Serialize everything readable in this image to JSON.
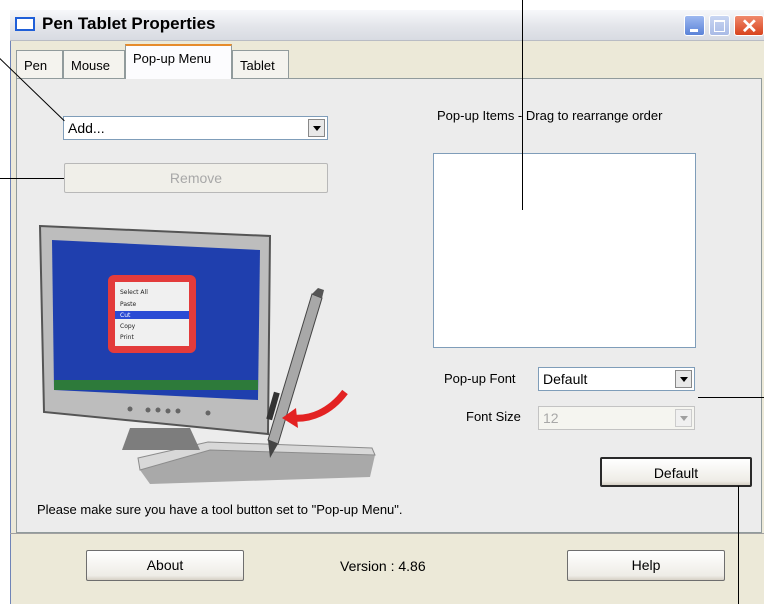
{
  "window": {
    "title": "Pen Tablet Properties"
  },
  "tabs": [
    {
      "label": "Pen"
    },
    {
      "label": "Mouse"
    },
    {
      "label": "Pop-up Menu"
    },
    {
      "label": "Tablet"
    }
  ],
  "popup_menu": {
    "add_select": {
      "value": "Add..."
    },
    "remove_label": "Remove",
    "items_heading": "Pop-up Items - Drag to rearrange order",
    "items": [],
    "font_label": "Pop-up Font",
    "font_value": "Default",
    "font_size_label": "Font Size",
    "font_size_value": "12",
    "default_label": "Default",
    "note": "Please make sure you have a tool button set to \"Pop-up Menu\".",
    "illustration_menu": [
      "Select All",
      "Paste",
      "Cut",
      "Copy",
      "Print"
    ]
  },
  "footer": {
    "about_label": "About",
    "version_text": "Version : 4.86",
    "help_label": "Help"
  },
  "colors": {
    "window_bg": "#ece9d8",
    "selected_tab_accent": "#e68b2c",
    "illustration_screen": "#1f3fae",
    "illustration_arrow": "#e32222"
  }
}
